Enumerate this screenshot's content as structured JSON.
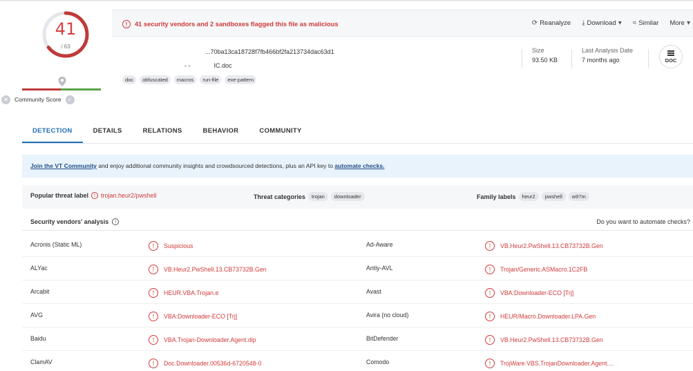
{
  "score": {
    "detections": "41",
    "total": "/ 63",
    "community_label": "Community Score",
    "minus_icon": "x-icon",
    "plus_icon": "check-icon"
  },
  "header": {
    "flag_text": "41 security vendors and 2 sandboxes flagged this file as malicious",
    "actions": {
      "reanalyze": "Reanalyze",
      "download": "Download",
      "similar": "Similar",
      "more": "More"
    },
    "hash": "...70ba13ca18728f7fb466bf2fa213734dac63d1",
    "filename": "IC.doc",
    "filename_prefix": "- -",
    "tags": [
      "doc",
      "obfuscated",
      "macros",
      "run-file",
      "exe-pattern"
    ],
    "size_label": "Size",
    "size_value": "93.50 KB",
    "date_label": "Last Analysis Date",
    "date_value": "7 months ago",
    "filetype": "DOC"
  },
  "tabs": [
    "DETECTION",
    "DETAILS",
    "RELATIONS",
    "BEHAVIOR",
    "COMMUNITY"
  ],
  "banner": {
    "link1": "Join the VT Community",
    "middle": " and enjoy additional community insights and crowdsourced detections, plus an API key to ",
    "link2": "automate checks."
  },
  "threat": {
    "popular_label": "Popular threat label",
    "popular_value": "trojan.heur2/pwshell",
    "categories_label": "Threat categories",
    "categories": [
      "trojan",
      "downloader"
    ],
    "family_label": "Family labels",
    "families": [
      "heur2",
      "pwshell",
      "w97m"
    ]
  },
  "vendors": {
    "title": "Security vendors' analysis",
    "automate": "Do you want to automate checks?",
    "rows": [
      {
        "v1": "Acronis (Static ML)",
        "r1": "Suspicious",
        "v2": "Ad-Aware",
        "r2": "VB.Heur2.PwShell.13.CB73732B.Gen"
      },
      {
        "v1": "ALYac",
        "r1": "VB.Heur2.PwShell.13.CB73732B.Gen",
        "v2": "Antiy-AVL",
        "r2": "Trojan/Generic.ASMacro.1C2FB"
      },
      {
        "v1": "Arcabit",
        "r1": "HEUR.VBA.Trojan.e",
        "v2": "Avast",
        "r2": "VBA:Downloader-ECO [Trj]"
      },
      {
        "v1": "AVG",
        "r1": "VBA:Downloader-ECO [Trj]",
        "v2": "Avira (no cloud)",
        "r2": "HEUR/Macro.Downloader.LPA.Gen"
      },
      {
        "v1": "Baidu",
        "r1": "VBA.Trojan-Downloader.Agent.dip",
        "v2": "BitDefender",
        "r2": "VB.Heur2.PwShell.13.CB73732B.Gen"
      },
      {
        "v1": "ClamAV",
        "r1": "Doc.Downloader.00536d-6720548-0",
        "v2": "Comodo",
        "r2": "TrojWare.VBS.TrojanDownloader.Agent...."
      }
    ]
  },
  "colors": {
    "danger": "#d03a3a",
    "accent": "#1f6fb5",
    "banner_bg": "#e8f3fb"
  }
}
